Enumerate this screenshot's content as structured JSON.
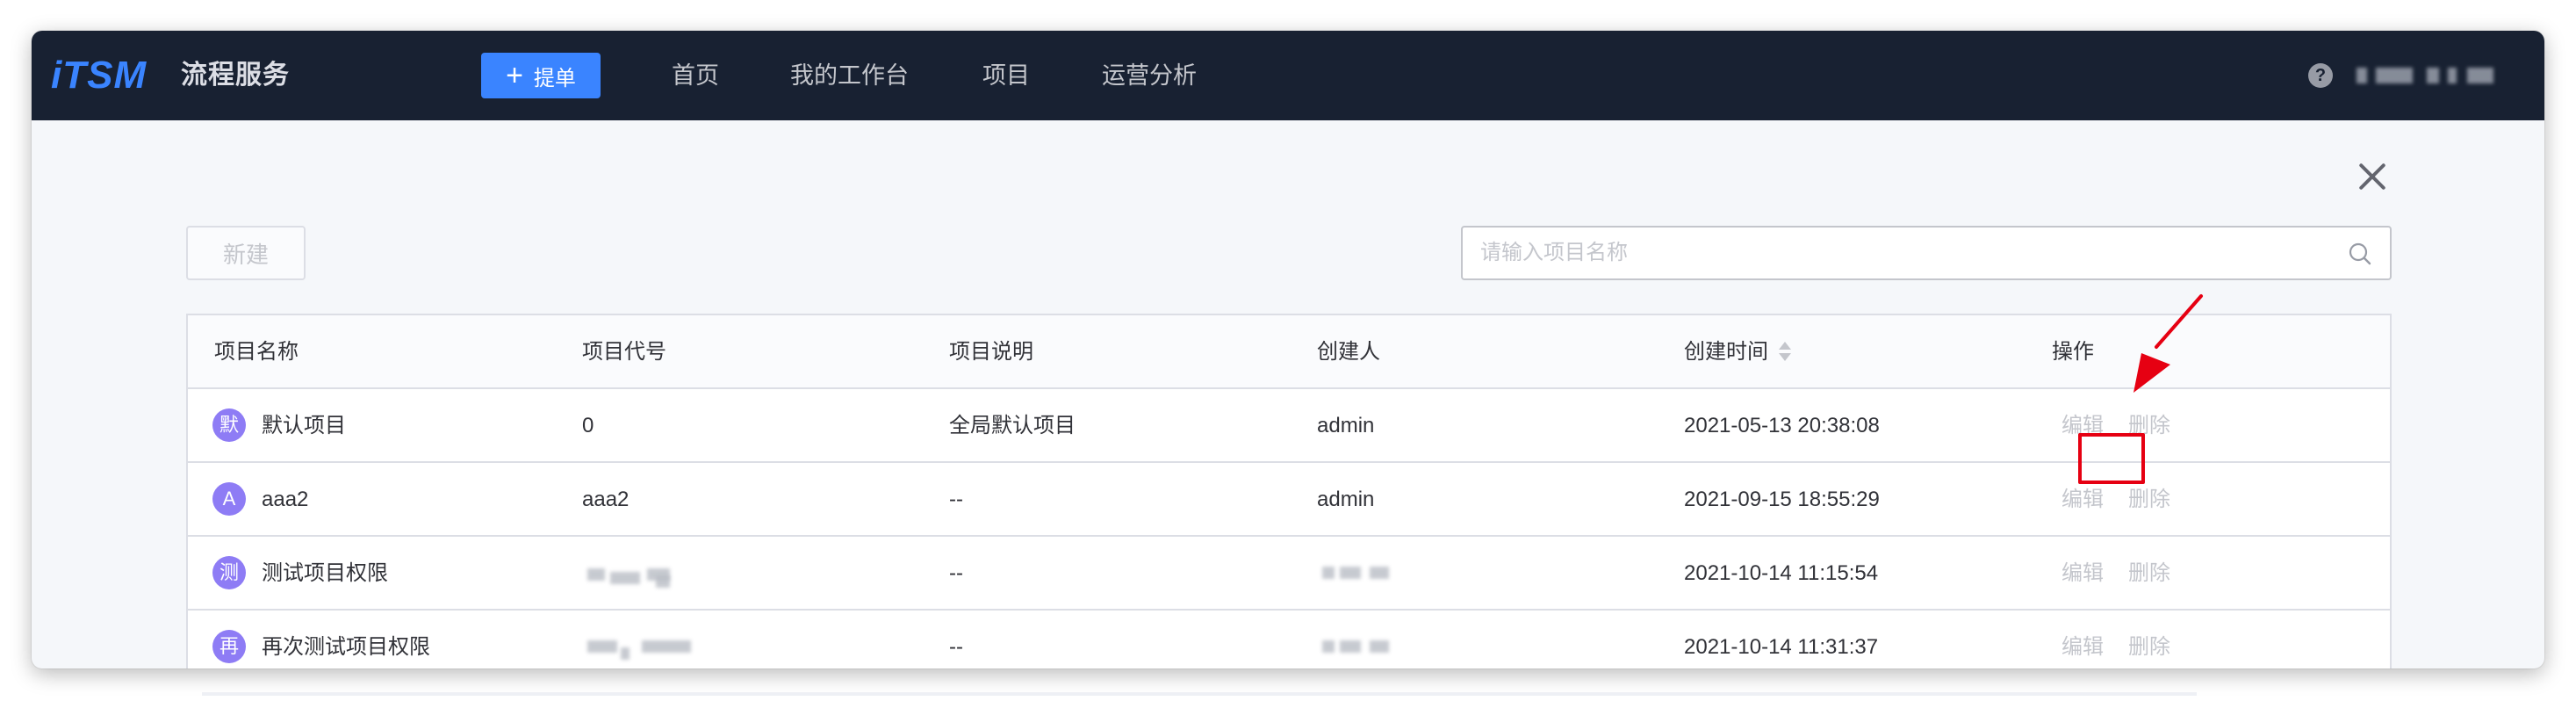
{
  "header": {
    "logo": "iTSM",
    "app_name": "流程服务",
    "create_ticket_label": "提单",
    "nav": [
      "首页",
      "我的工作台",
      "项目",
      "运营分析"
    ]
  },
  "toolbar": {
    "new_label": "新建",
    "search_placeholder": "请输入项目名称"
  },
  "table": {
    "columns": [
      "项目名称",
      "项目代号",
      "项目说明",
      "创建人",
      "创建时间",
      "操作"
    ],
    "rows": [
      {
        "avatar": "默",
        "name": "默认项目",
        "code": "0",
        "desc": "全局默认项目",
        "creator": "admin",
        "created": "2021-05-13 20:38:08",
        "edit": "编辑",
        "delete": "删除"
      },
      {
        "avatar": "A",
        "name": "aaa2",
        "code": "aaa2",
        "desc": "--",
        "creator": "admin",
        "created": "2021-09-15 18:55:29",
        "edit": "编辑",
        "delete": "删除"
      },
      {
        "avatar": "测",
        "name": "测试项目权限",
        "code": "",
        "desc": "--",
        "creator": "",
        "created": "2021-10-14 11:15:54",
        "edit": "编辑",
        "delete": "删除"
      },
      {
        "avatar": "再",
        "name": "再次测试项目权限",
        "code": "",
        "desc": "--",
        "creator": "",
        "created": "2021-10-14 11:31:37",
        "edit": "编辑",
        "delete": "删除"
      }
    ]
  },
  "colors": {
    "topbar": "#182132",
    "primary": "#3a84ff",
    "highlight": "#e60012",
    "avatar": "#8e7cf5"
  }
}
